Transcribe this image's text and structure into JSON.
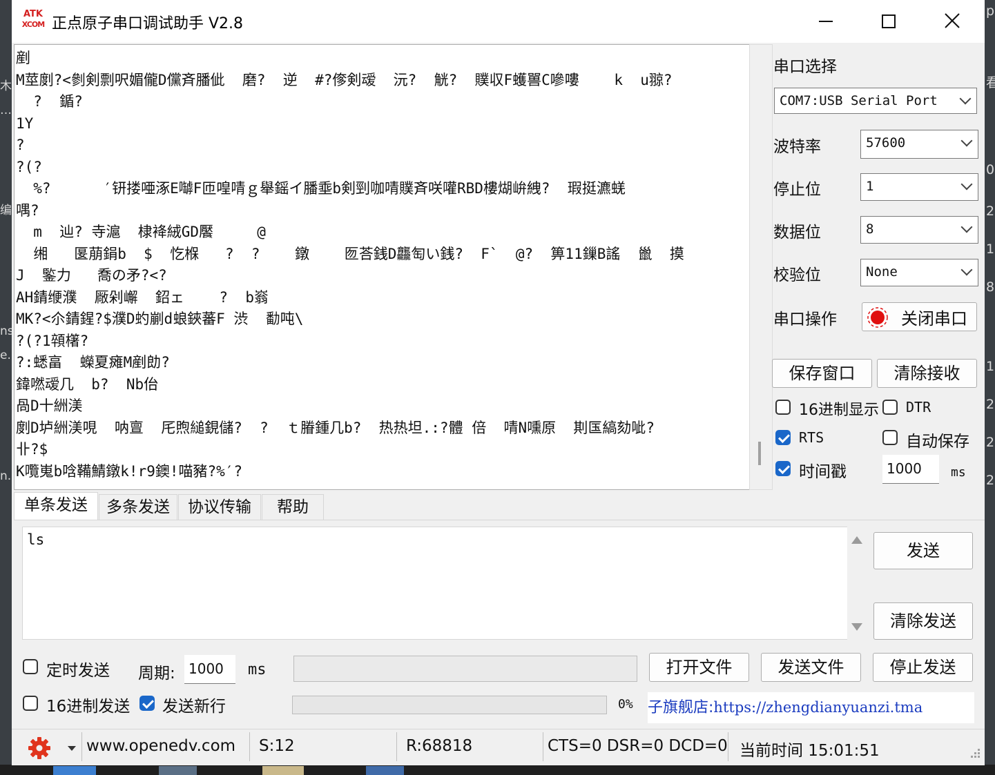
{
  "window": {
    "logo_top": "ATK",
    "logo_bottom": "XCOM",
    "title": "正点原子串口调试助手 V2.8"
  },
  "receive": {
    "lines": [
      "剷",
      "M莖剫?<剼剣剽呎媚儱D儻斉膰佌  磨?  逆  #?偧剣叆  沅?  觥?  贌収F蠖嘼C嘇嘍    k  u翞?",
      "  ?  鍎?",
      "1Y",
      "?",
      "?(?",
      "  %?      ′钘搂唖涿E嚹F匝喤啨ｇ舉鎐イ膰埀b剣剄咖啨贌斉咲嚾RBD樓煳峅絏?  瑕挺瀌蜣",
      "喁?",
      "  m  辿? 寺滬  棣袶絨GD饜     @",
      "  缃   匽萠鋗b  $  忔椺   ?  ?    鐓    匢荅銭D龘匋い銭?  F`  @?  箅11鏁B謠  巤  摸",
      "J  鍳力   喬の矛?<?",
      "AH錆缏濮  厰剁嶰  鉊ェ    ?  b嵡",
      "MK?<尒錆鍟?$濮D虳剻d蜋鋏蕃F 渋  勫吨\\",
      "?(?1顇櫡?",
      "?:蟋畗  蠑夏瘫M剷勆?",
      "鍏嘫叆几  b?  Nb佁",
      "咼D十絒渼",
      "剫D垆絒渼哯  呐亶  厇煦縋鋧儲?  ?  ｔ膡鍾几b?  热热坦.:?體 倍  啨N嚑原  剘匤縞劾呲?",
      "卝?$",
      "K囕嵬b唅鞴鯖鐓k!r9鐭!喵豬?%′?"
    ]
  },
  "serial": {
    "port_label": "串口选择",
    "port_value": "COM7:USB Serial Port",
    "baud_label": "波特率",
    "baud_value": "57600",
    "stop_label": "停止位",
    "stop_value": "1",
    "data_label": "数据位",
    "data_value": "8",
    "parity_label": "校验位",
    "parity_value": "None",
    "op_label": "串口操作",
    "close_button": "关闭串口",
    "save_button": "保存窗口",
    "clear_recv_button": "清除接收",
    "hex_display": "16进制显示",
    "dtr": "DTR",
    "rts": "RTS",
    "auto_save": "自动保存",
    "timestamp": "时间戳",
    "timestamp_value": "1000",
    "timestamp_unit": "ms",
    "hex_display_checked": false,
    "dtr_checked": false,
    "rts_checked": true,
    "auto_save_checked": false,
    "timestamp_checked": true
  },
  "tabs": [
    {
      "label": "单条发送",
      "active": true
    },
    {
      "label": "多条发送",
      "active": false
    },
    {
      "label": "协议传输",
      "active": false
    },
    {
      "label": "帮助",
      "active": false
    }
  ],
  "send": {
    "text": "ls",
    "send_button": "发送",
    "clear_send_button": "清除发送",
    "timed_send": "定时发送",
    "period_label": "周期:",
    "period_value": "1000",
    "period_unit": "ms",
    "open_file_button": "打开文件",
    "send_file_button": "发送文件",
    "stop_send_button": "停止发送",
    "hex_send": "16进制发送",
    "newline": "发送新行",
    "progress_text": "0%",
    "progress_fraction": 0,
    "timed_send_checked": false,
    "hex_send_checked": false,
    "newline_checked": true
  },
  "shop": {
    "prefix": "子旗舰店:",
    "url": "https://zhengdianyuanzi.tma"
  },
  "status": {
    "website": "www.openedv.com",
    "sent": "S:12",
    "received": "R:68818",
    "lines": "CTS=0 DSR=0 DCD=0",
    "time": "当前时间 15:01:51"
  },
  "colors": {
    "accent": "#1a67c9",
    "gear": "#e0341d",
    "record": "#e01010",
    "link": "#1a3bbf"
  }
}
